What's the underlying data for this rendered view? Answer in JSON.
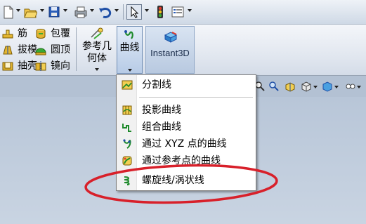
{
  "ribbon": {
    "features": [
      {
        "label": "筋",
        "icon": "rib-icon"
      },
      {
        "label": "拔模",
        "icon": "draft-icon"
      },
      {
        "label": "抽壳",
        "icon": "shell-icon"
      },
      {
        "label": "包覆",
        "icon": "wrap-icon"
      },
      {
        "label": "圆顶",
        "icon": "dome-icon"
      },
      {
        "label": "镜向",
        "icon": "mirror-icon"
      }
    ],
    "reference_geometry": {
      "line1": "参考几",
      "line2": "何体"
    },
    "curves": {
      "line1": "曲线",
      "line2": "线"
    },
    "instant3d": "Instant3D"
  },
  "curves_menu": {
    "items": [
      {
        "label": "分割线",
        "icon": "split-line-icon"
      },
      {
        "label": "投影曲线",
        "icon": "projected-curve-icon"
      },
      {
        "label": "组合曲线",
        "icon": "composite-curve-icon"
      },
      {
        "label": "通过 XYZ 点的曲线",
        "icon": "curve-through-xyz-icon"
      },
      {
        "label": "通过参考点的曲线",
        "icon": "curve-through-reference-icon"
      },
      {
        "label": "螺旋线/涡状线",
        "icon": "helix-spiral-icon"
      }
    ],
    "highlighted_item": "螺旋线/涡状线"
  },
  "colors": {
    "annotation": "#d8202a",
    "ribbon_bg": "#dfe5ee",
    "viewport_bg": "#b9c7d8",
    "menu_bg": "#ffffff"
  }
}
